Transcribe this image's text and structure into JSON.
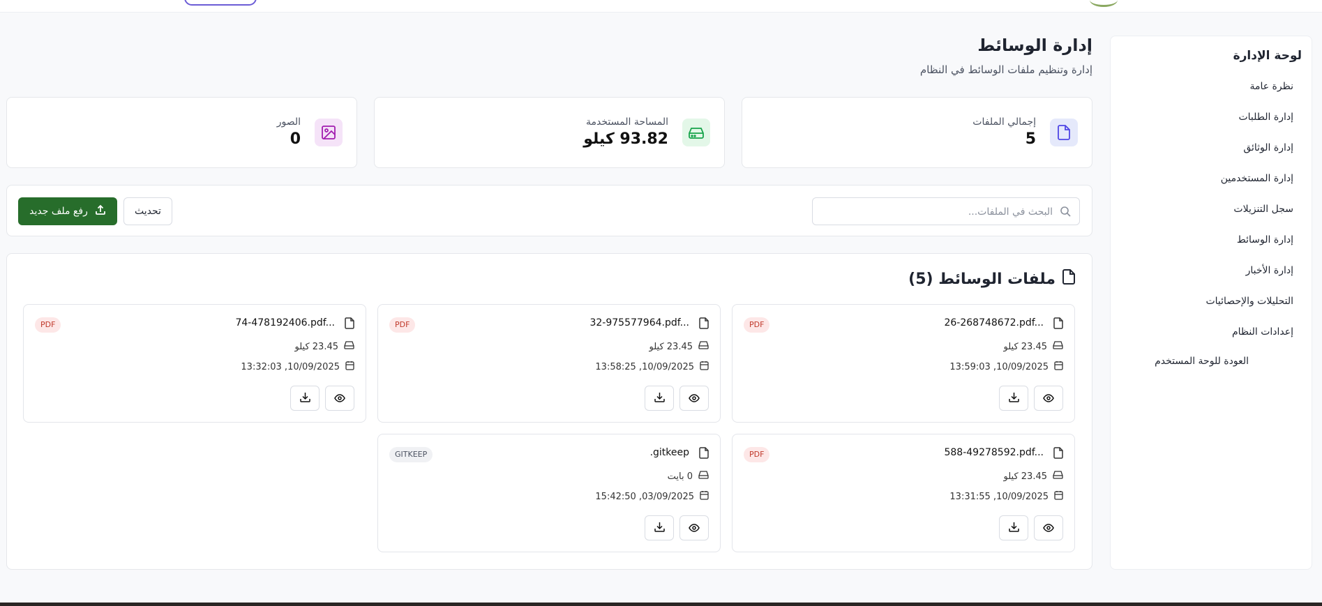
{
  "sidebar": {
    "title": "لوحة الإدارة",
    "items": [
      {
        "label": "نظرة عامة"
      },
      {
        "label": "إدارة الطلبات"
      },
      {
        "label": "إدارة الوثائق"
      },
      {
        "label": "إدارة المستخدمين"
      },
      {
        "label": "سجل التنزيلات"
      },
      {
        "label": "إدارة الوسائط"
      },
      {
        "label": "إدارة الأخبار"
      },
      {
        "label": "التحليلات والإحصائيات"
      },
      {
        "label": "إعدادات النظام"
      }
    ],
    "back_label": "العودة للوحة المستخدم"
  },
  "header": {
    "title": "إدارة الوسائط",
    "subtitle": "إدارة وتنظيم ملفات الوسائط في النظام"
  },
  "stats": [
    {
      "label": "إجمالي الملفات",
      "value": "5",
      "icon": "file-icon",
      "color": "#4f46e5",
      "bg": "#e5e9fb"
    },
    {
      "label": "المساحة المستخدمة",
      "value": "93.82 كيلو",
      "icon": "hard-drive-icon",
      "color": "#16a34a",
      "bg": "#e3f7e8"
    },
    {
      "label": "الصور",
      "value": "0",
      "icon": "image-icon",
      "color": "#a21caf",
      "bg": "#f5e3f8"
    }
  ],
  "toolbar": {
    "search_placeholder": "البحث في الملفات...",
    "refresh_label": "تحديث",
    "upload_label": "رفع ملف جديد"
  },
  "files": {
    "heading": "ملفات الوسائط (5)",
    "items": [
      {
        "name": "26-268748672.pdf...",
        "badge": "PDF",
        "size": "23.45 كيلو",
        "date": "10/09/2025, 13:59:03"
      },
      {
        "name": "32-975577964.pdf...",
        "badge": "PDF",
        "size": "23.45 كيلو",
        "date": "10/09/2025, 13:58:25"
      },
      {
        "name": "74-478192406.pdf...",
        "badge": "PDF",
        "size": "23.45 كيلو",
        "date": "10/09/2025, 13:32:03"
      },
      {
        "name": "588-49278592.pdf...",
        "badge": "PDF",
        "size": "23.45 كيلو",
        "date": "10/09/2025, 13:31:55"
      },
      {
        "name": ".gitkeep",
        "badge": "GITKEEP",
        "size": "0 بايت",
        "date": "03/09/2025, 15:42:50"
      }
    ]
  },
  "colors": {
    "primary": "#276d2b",
    "pdf_badge": "#c0392b"
  }
}
